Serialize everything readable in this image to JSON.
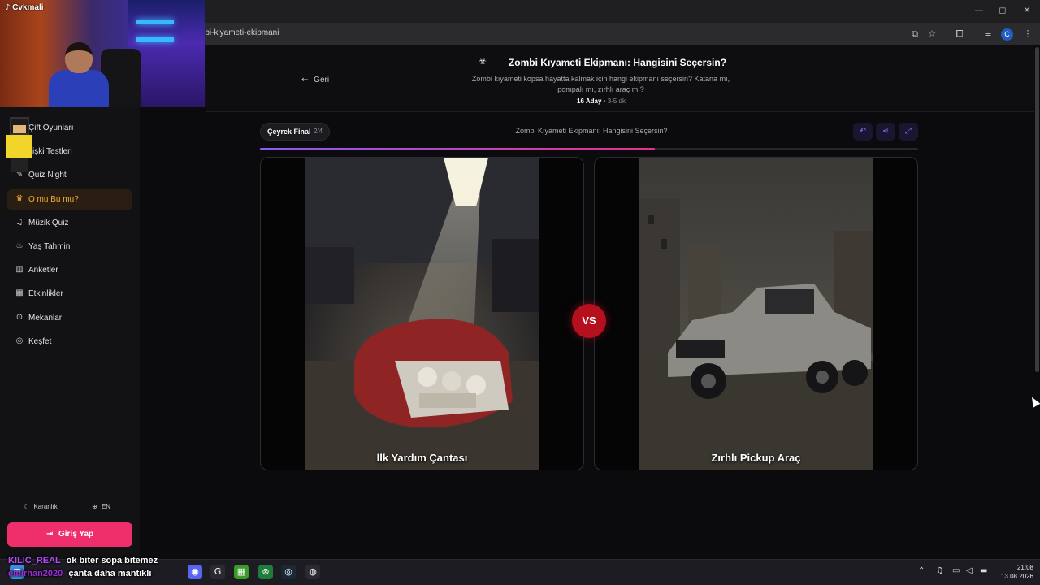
{
  "browser": {
    "url": "mbi-kiyameti-ekipmani",
    "profile_initial": "C",
    "window_controls": [
      "—",
      "◻",
      "✕"
    ]
  },
  "webcam": {
    "streamer": "Cvkmali"
  },
  "sidebar": {
    "items": [
      {
        "label": "Çift Oyunları",
        "icon": "heart-icon",
        "active": false
      },
      {
        "label": "İlişki Testleri",
        "icon": "link-icon",
        "active": false
      },
      {
        "label": "Quiz Night",
        "icon": "quiz-icon",
        "active": false
      },
      {
        "label": "O mu Bu mu?",
        "icon": "trophy-icon",
        "active": true
      },
      {
        "label": "Müzik Quiz",
        "icon": "headphones-icon",
        "active": false
      },
      {
        "label": "Yaş Tahmini",
        "icon": "cake-icon",
        "active": false
      },
      {
        "label": "Anketler",
        "icon": "bar-chart-icon",
        "active": false
      },
      {
        "label": "Etkinlikler",
        "icon": "calendar-icon",
        "active": false
      },
      {
        "label": "Mekanlar",
        "icon": "map-pin-icon",
        "active": false
      },
      {
        "label": "Keşfet",
        "icon": "compass-icon",
        "active": false
      }
    ],
    "theme_label": "Karanlık",
    "language_label": "EN",
    "login_label": "Giriş Yap"
  },
  "header": {
    "back_label": "Geri",
    "title": "Zombi Kıyameti Ekipmanı: Hangisini Seçersin?",
    "description": "Zombi kıyameti kopsa hayatta kalmak için hangi ekipmanı seçersin? Katana mı, pompalı mı, zırhlı araç mı?",
    "candidates": "16 Aday",
    "duration": "3-5 dk"
  },
  "game": {
    "round_name": "Çeyrek Final",
    "round_counter": "2/4",
    "game_title": "Zombi Kıyameti Ekipmanı: Hangisini Seçersin?",
    "progress": 0.6,
    "vs_label": "VS",
    "left_option": "İlk Yardım Çantası",
    "right_option": "Zırhlı Pickup Araç",
    "accent_colors": {
      "start": "#8b5cf6",
      "end": "#e8318a",
      "vs": "#b4101e",
      "login": "#ef2f6b",
      "active": "#f4b13a"
    }
  },
  "chat": [
    {
      "user": "KILIC_REAL",
      "message": "ok biter sopa bitemez"
    },
    {
      "user": "emirhan2020",
      "message": "çanta daha mantıklı"
    }
  ],
  "taskbar": {
    "time": "21:08",
    "date": "13.08.2026"
  }
}
